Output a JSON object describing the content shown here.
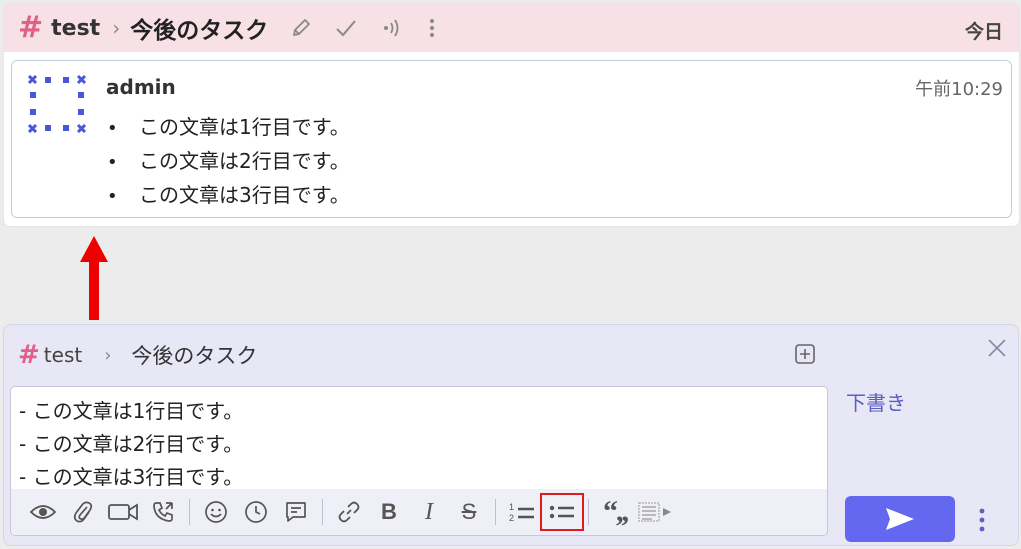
{
  "header": {
    "stream": "test",
    "topic": "今後のタスク",
    "date_label": "今日",
    "icons": [
      "hash-icon",
      "chevron-right-icon",
      "pencil-icon",
      "check-icon",
      "audio-icon",
      "more-vertical-icon"
    ]
  },
  "message": {
    "sender": "admin",
    "time": "午前10:29",
    "bullet": "•",
    "items": [
      "この文章は1行目です。",
      "この文章は2行目です。",
      "この文章は3行目です。"
    ]
  },
  "compose": {
    "stream": "test",
    "topic": "今後のタスク",
    "drafts_label": "下書き",
    "lines": [
      "- この文章は1行目です。",
      "- この文章は2行目です。",
      "- この文章は3行目です。"
    ],
    "toolbar": {
      "bold_label": "B",
      "italic_label": "I",
      "strike_label": "S",
      "quote_label": "“,,",
      "ordered_list_num": "1",
      "ordered_list_num2": "2",
      "highlighted_button": "bulleted-list-button"
    }
  },
  "colors": {
    "header_bg": "#f8e1e6",
    "stream_hash": "#e0608a",
    "compose_bg": "#e7e7f6",
    "send_button": "#6468f0",
    "drafts_link": "#5a5fc0",
    "annotation_red": "#e01b1b"
  }
}
